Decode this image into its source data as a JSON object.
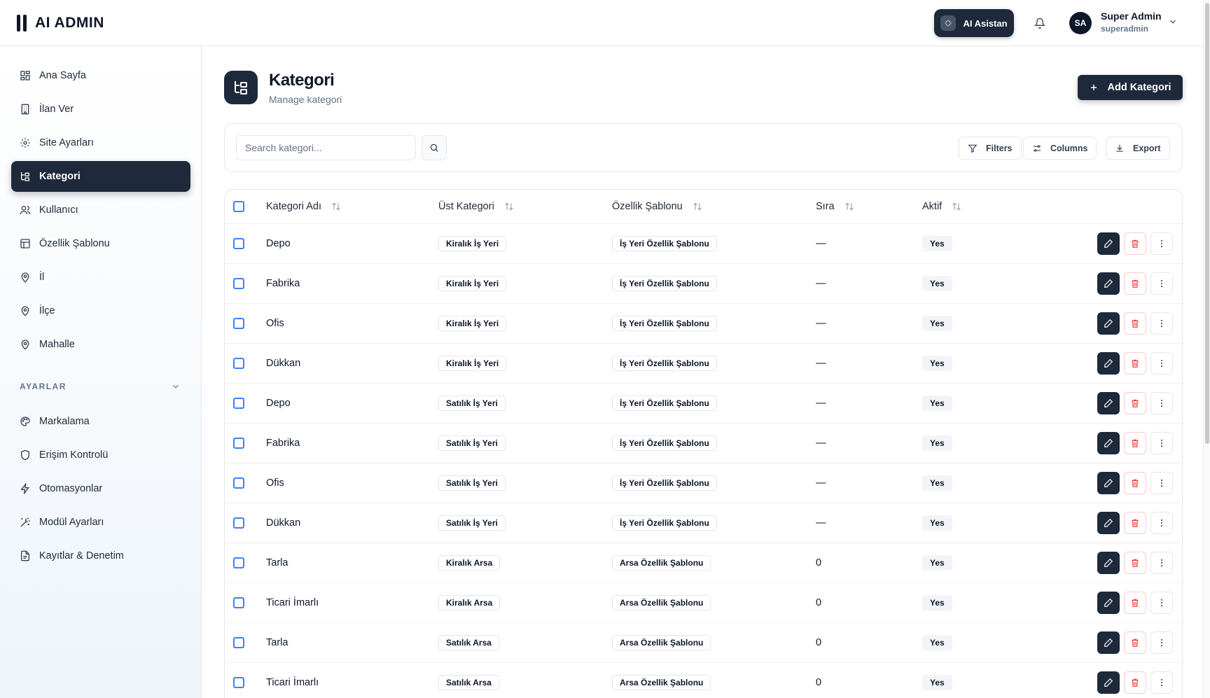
{
  "app": {
    "title": "AI ADMIN"
  },
  "header": {
    "ai_button": "AI Asistan",
    "user": {
      "initials": "SA",
      "name": "Super Admin",
      "role": "superadmin"
    }
  },
  "sidebar": {
    "items": [
      {
        "label": "Ana Sayfa",
        "icon": "grid-icon",
        "active": false
      },
      {
        "label": "İlan Ver",
        "icon": "building-icon",
        "active": false
      },
      {
        "label": "Site Ayarları",
        "icon": "gear-icon",
        "active": false
      },
      {
        "label": "Kategori",
        "icon": "tree-icon",
        "active": true
      },
      {
        "label": "Kullanıcı",
        "icon": "users-icon",
        "active": false
      },
      {
        "label": "Özellik Şablonu",
        "icon": "layout-icon",
        "active": false
      },
      {
        "label": "İl",
        "icon": "map-pin-icon",
        "active": false
      },
      {
        "label": "İlçe",
        "icon": "map-pin-icon",
        "active": false
      },
      {
        "label": "Mahalle",
        "icon": "map-pin-icon",
        "active": false
      }
    ],
    "section_label": "AYARLAR",
    "settings_items": [
      {
        "label": "Markalama",
        "icon": "palette-icon"
      },
      {
        "label": "Erişim Kontrolü",
        "icon": "shield-icon"
      },
      {
        "label": "Otomasyonlar",
        "icon": "bolt-icon"
      },
      {
        "label": "Modül Ayarları",
        "icon": "wand-icon"
      },
      {
        "label": "Kayıtlar & Denetim",
        "icon": "file-icon"
      }
    ]
  },
  "page": {
    "title": "Kategori",
    "subtitle": "Manage kategori",
    "add_button": "Add Kategori"
  },
  "toolbar": {
    "search_placeholder": "Search kategori...",
    "filters": "Filters",
    "columns": "Columns",
    "export": "Export"
  },
  "table": {
    "headers": [
      "Kategori Adı",
      "Üst Kategori",
      "Özellik Şablonu",
      "Sıra",
      "Aktif"
    ],
    "rows": [
      {
        "name": "Depo",
        "parent": "Kiralık İş Yeri",
        "template": "İş Yeri Özellik Şablonu",
        "order": "—",
        "active": "Yes"
      },
      {
        "name": "Fabrika",
        "parent": "Kiralık İş Yeri",
        "template": "İş Yeri Özellik Şablonu",
        "order": "—",
        "active": "Yes"
      },
      {
        "name": "Ofis",
        "parent": "Kiralık İş Yeri",
        "template": "İş Yeri Özellik Şablonu",
        "order": "—",
        "active": "Yes"
      },
      {
        "name": "Dükkan",
        "parent": "Kiralık İş Yeri",
        "template": "İş Yeri Özellik Şablonu",
        "order": "—",
        "active": "Yes"
      },
      {
        "name": "Depo",
        "parent": "Satılık İş Yeri",
        "template": "İş Yeri Özellik Şablonu",
        "order": "—",
        "active": "Yes"
      },
      {
        "name": "Fabrika",
        "parent": "Satılık İş Yeri",
        "template": "İş Yeri Özellik Şablonu",
        "order": "—",
        "active": "Yes"
      },
      {
        "name": "Ofis",
        "parent": "Satılık İş Yeri",
        "template": "İş Yeri Özellik Şablonu",
        "order": "—",
        "active": "Yes"
      },
      {
        "name": "Dükkan",
        "parent": "Satılık İş Yeri",
        "template": "İş Yeri Özellik Şablonu",
        "order": "—",
        "active": "Yes"
      },
      {
        "name": "Tarla",
        "parent": "Kiralık Arsa",
        "template": "Arsa Özellik Şablonu",
        "order": "0",
        "active": "Yes"
      },
      {
        "name": "Ticari İmarlı",
        "parent": "Kiralık Arsa",
        "template": "Arsa Özellik Şablonu",
        "order": "0",
        "active": "Yes"
      },
      {
        "name": "Tarla",
        "parent": "Satılık Arsa",
        "template": "Arsa Özellik Şablonu",
        "order": "0",
        "active": "Yes"
      },
      {
        "name": "Ticari İmarlı",
        "parent": "Satılık Arsa",
        "template": "Arsa Özellik Şablonu",
        "order": "0",
        "active": "Yes"
      }
    ]
  },
  "colors": {
    "primary": "#1e293b",
    "checkbox": "#3b82f6",
    "danger": "#ef4444",
    "muted": "#64748b"
  }
}
